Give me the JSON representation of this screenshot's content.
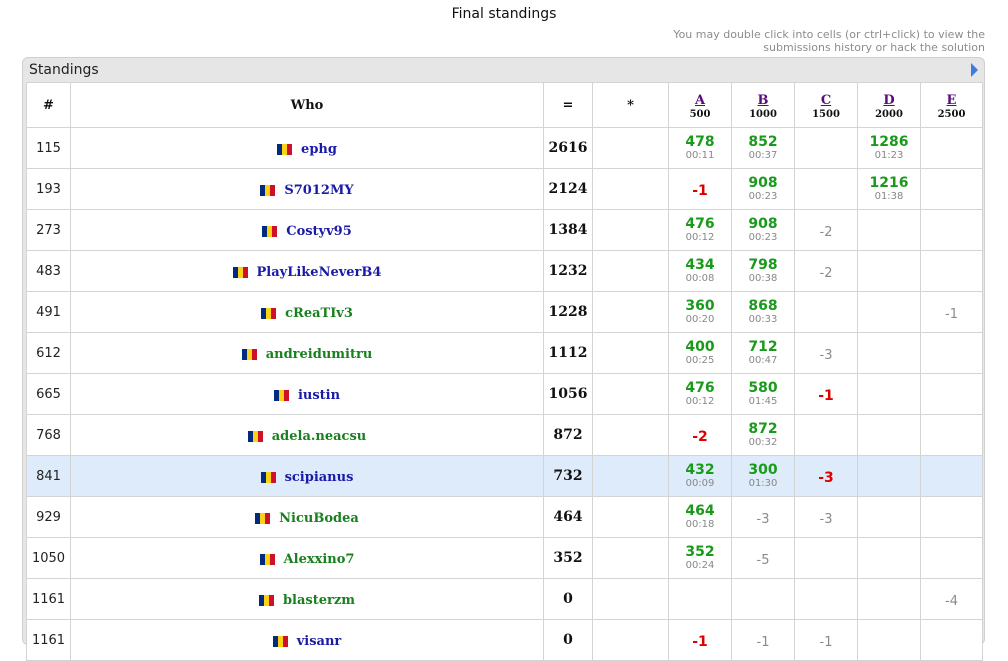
{
  "page": {
    "title": "Final standings",
    "hint": "You may double click into cells (or ctrl+click) to view the submissions history or hack the solution"
  },
  "panel": {
    "title": "Standings"
  },
  "colors": {
    "ok": "#1a9a1a",
    "fail": "#dd0000",
    "neutral": "#8a8a8a",
    "handle_blue": "#1a1aa8",
    "handle_green": "#18801e",
    "highlight": "#ddebfa"
  },
  "table": {
    "headers": {
      "rank": "#",
      "who": "Who",
      "score": "=",
      "hacks": "*"
    },
    "problems": [
      {
        "letter": "A",
        "points": "500"
      },
      {
        "letter": "B",
        "points": "1000"
      },
      {
        "letter": "C",
        "points": "1500"
      },
      {
        "letter": "D",
        "points": "2000"
      },
      {
        "letter": "E",
        "points": "2500"
      }
    ],
    "rows": [
      {
        "rank": "115",
        "handle": "ephg",
        "color": "blue",
        "score": "2616",
        "hacks": "",
        "cells": [
          {
            "kind": "ok",
            "pts": "478",
            "time": "00:11"
          },
          {
            "kind": "ok",
            "pts": "852",
            "time": "00:37"
          },
          {
            "kind": "empty"
          },
          {
            "kind": "ok",
            "pts": "1286",
            "time": "01:23"
          },
          {
            "kind": "empty"
          }
        ]
      },
      {
        "rank": "193",
        "handle": "S7012MY",
        "color": "blue",
        "score": "2124",
        "hacks": "",
        "cells": [
          {
            "kind": "fail",
            "text": "-1"
          },
          {
            "kind": "ok",
            "pts": "908",
            "time": "00:23"
          },
          {
            "kind": "empty"
          },
          {
            "kind": "ok",
            "pts": "1216",
            "time": "01:38"
          },
          {
            "kind": "empty"
          }
        ]
      },
      {
        "rank": "273",
        "handle": "Costyv95",
        "color": "blue",
        "score": "1384",
        "hacks": "",
        "cells": [
          {
            "kind": "ok",
            "pts": "476",
            "time": "00:12"
          },
          {
            "kind": "ok",
            "pts": "908",
            "time": "00:23"
          },
          {
            "kind": "grey",
            "text": "-2"
          },
          {
            "kind": "empty"
          },
          {
            "kind": "empty"
          }
        ]
      },
      {
        "rank": "483",
        "handle": "PlayLikeNeverB4",
        "color": "blue",
        "score": "1232",
        "hacks": "",
        "cells": [
          {
            "kind": "ok",
            "pts": "434",
            "time": "00:08"
          },
          {
            "kind": "ok",
            "pts": "798",
            "time": "00:38"
          },
          {
            "kind": "grey",
            "text": "-2"
          },
          {
            "kind": "empty"
          },
          {
            "kind": "empty"
          }
        ]
      },
      {
        "rank": "491",
        "handle": "cReaTIv3",
        "color": "green",
        "score": "1228",
        "hacks": "",
        "cells": [
          {
            "kind": "ok",
            "pts": "360",
            "time": "00:20"
          },
          {
            "kind": "ok",
            "pts": "868",
            "time": "00:33"
          },
          {
            "kind": "empty"
          },
          {
            "kind": "empty"
          },
          {
            "kind": "grey",
            "text": "-1"
          }
        ]
      },
      {
        "rank": "612",
        "handle": "andreidumitru",
        "color": "green",
        "score": "1112",
        "hacks": "",
        "cells": [
          {
            "kind": "ok",
            "pts": "400",
            "time": "00:25"
          },
          {
            "kind": "ok",
            "pts": "712",
            "time": "00:47"
          },
          {
            "kind": "grey",
            "text": "-3"
          },
          {
            "kind": "empty"
          },
          {
            "kind": "empty"
          }
        ]
      },
      {
        "rank": "665",
        "handle": "iustin",
        "color": "blue",
        "score": "1056",
        "hacks": "",
        "cells": [
          {
            "kind": "ok",
            "pts": "476",
            "time": "00:12"
          },
          {
            "kind": "ok",
            "pts": "580",
            "time": "01:45"
          },
          {
            "kind": "fail",
            "text": "-1"
          },
          {
            "kind": "empty"
          },
          {
            "kind": "empty"
          }
        ]
      },
      {
        "rank": "768",
        "handle": "adela.neacsu",
        "color": "green",
        "score": "872",
        "hacks": "",
        "cells": [
          {
            "kind": "fail",
            "text": "-2"
          },
          {
            "kind": "ok",
            "pts": "872",
            "time": "00:32"
          },
          {
            "kind": "empty"
          },
          {
            "kind": "empty"
          },
          {
            "kind": "empty"
          }
        ]
      },
      {
        "rank": "841",
        "handle": "scipianus",
        "color": "blue",
        "score": "732",
        "hacks": "",
        "highlight": true,
        "cells": [
          {
            "kind": "ok",
            "pts": "432",
            "time": "00:09"
          },
          {
            "kind": "ok",
            "pts": "300",
            "time": "01:30"
          },
          {
            "kind": "fail",
            "text": "-3"
          },
          {
            "kind": "empty"
          },
          {
            "kind": "empty"
          }
        ]
      },
      {
        "rank": "929",
        "handle": "NicuBodea",
        "color": "green",
        "score": "464",
        "hacks": "",
        "cells": [
          {
            "kind": "ok",
            "pts": "464",
            "time": "00:18"
          },
          {
            "kind": "grey",
            "text": "-3"
          },
          {
            "kind": "grey",
            "text": "-3"
          },
          {
            "kind": "empty"
          },
          {
            "kind": "empty"
          }
        ]
      },
      {
        "rank": "1050",
        "handle": "Alexxino7",
        "color": "green",
        "score": "352",
        "hacks": "",
        "cells": [
          {
            "kind": "ok",
            "pts": "352",
            "time": "00:24"
          },
          {
            "kind": "grey",
            "text": "-5"
          },
          {
            "kind": "empty"
          },
          {
            "kind": "empty"
          },
          {
            "kind": "empty"
          }
        ]
      },
      {
        "rank": "1161",
        "handle": "blasterzm",
        "color": "green",
        "score": "0",
        "hacks": "",
        "short": true,
        "cells": [
          {
            "kind": "empty"
          },
          {
            "kind": "empty"
          },
          {
            "kind": "empty"
          },
          {
            "kind": "empty"
          },
          {
            "kind": "grey",
            "text": "-4"
          }
        ]
      },
      {
        "rank": "1161",
        "handle": "visanr",
        "color": "blue",
        "score": "0",
        "hacks": "",
        "short": true,
        "cells": [
          {
            "kind": "fail",
            "text": "-1"
          },
          {
            "kind": "grey",
            "text": "-1"
          },
          {
            "kind": "grey",
            "text": "-1"
          },
          {
            "kind": "empty"
          },
          {
            "kind": "empty"
          }
        ]
      }
    ]
  }
}
